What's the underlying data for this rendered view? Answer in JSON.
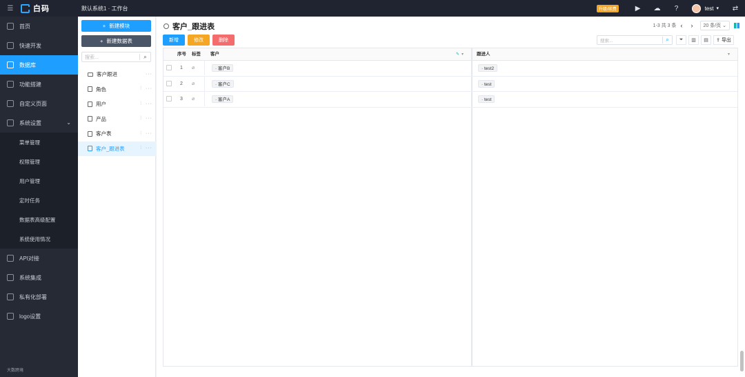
{
  "topbar": {
    "logo_text": "白码",
    "system_title": "默认系统1 · 工作台",
    "upgrade_label": "升级/续费",
    "username": "test"
  },
  "sidebar": {
    "items": [
      {
        "label": "首页",
        "icon": "home-icon"
      },
      {
        "label": "快速开发",
        "icon": "cube-icon"
      },
      {
        "label": "数据库",
        "icon": "database-icon",
        "active": true
      },
      {
        "label": "功能搭建",
        "icon": "tools-icon"
      },
      {
        "label": "自定义页面",
        "icon": "page-icon"
      },
      {
        "label": "系统设置",
        "icon": "monitor-icon"
      }
    ],
    "sub_items": [
      "菜单管理",
      "权限管理",
      "用户管理",
      "定时任务",
      "数据表高级配置",
      "系统使用情况"
    ],
    "items_after": [
      {
        "label": "API对接",
        "icon": "api-icon"
      },
      {
        "label": "系统集成",
        "icon": "integration-icon"
      },
      {
        "label": "私有化部署",
        "icon": "server-icon"
      },
      {
        "label": "logo设置",
        "icon": "image-icon"
      }
    ],
    "watermark": "大数跨境"
  },
  "tree": {
    "new_module_label": "新建模块",
    "new_table_label": "新建数据表",
    "search_placeholder": "搜索...",
    "items": [
      {
        "label": "客户跟进",
        "type": "folder"
      },
      {
        "label": "角色",
        "type": "table"
      },
      {
        "label": "用户",
        "type": "table"
      },
      {
        "label": "产品",
        "type": "table"
      },
      {
        "label": "客户表",
        "type": "table"
      },
      {
        "label": "客户_跟进表",
        "type": "table",
        "active": true
      }
    ]
  },
  "main": {
    "title": "客户_跟进表",
    "pager": {
      "range": "1-3",
      "total_label": "共 3 条",
      "per_page": "20 条/页"
    },
    "actions": {
      "add": "新增",
      "edit": "修改",
      "delete": "删除"
    },
    "search_placeholder": "搜索...",
    "export_label": "导出",
    "columns": {
      "seq": "序号",
      "tag": "标签",
      "customer": "客户",
      "follower": "跟进人"
    },
    "rows": [
      {
        "seq": "1",
        "customer": "客户B",
        "follower": "test2"
      },
      {
        "seq": "2",
        "customer": "客户C",
        "follower": "test"
      },
      {
        "seq": "3",
        "customer": "客户A",
        "follower": "test"
      }
    ]
  }
}
